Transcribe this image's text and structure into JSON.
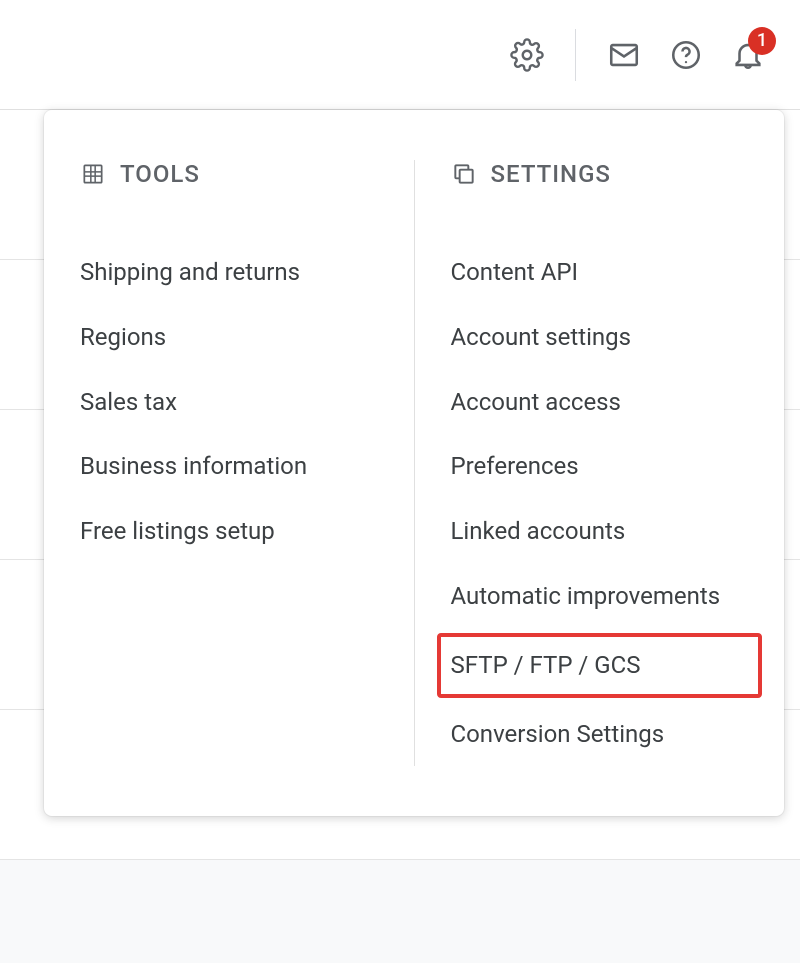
{
  "toolbar": {
    "notification_count": "1"
  },
  "dropdown": {
    "tools_header": "TOOLS",
    "settings_header": "SETTINGS",
    "tools_items": [
      "Shipping and returns",
      "Regions",
      "Sales tax",
      "Business information",
      "Free listings setup"
    ],
    "settings_items": [
      "Content API",
      "Account settings",
      "Account access",
      "Preferences",
      "Linked accounts",
      "Automatic improvements",
      "SFTP / FTP / GCS",
      "Conversion Settings"
    ],
    "highlighted_item": "SFTP / FTP / GCS"
  }
}
